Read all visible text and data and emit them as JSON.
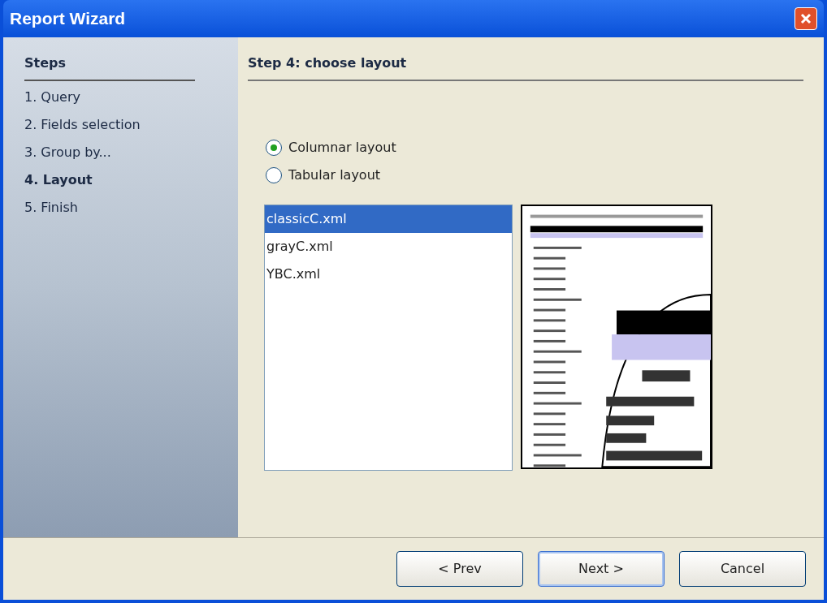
{
  "window": {
    "title": "Report Wizard"
  },
  "sidebar": {
    "heading": "Steps",
    "items": [
      {
        "label": "1. Query",
        "selected": false
      },
      {
        "label": "2. Fields selection",
        "selected": false
      },
      {
        "label": "3. Group by...",
        "selected": false
      },
      {
        "label": "4. Layout",
        "selected": true
      },
      {
        "label": "5. Finish",
        "selected": false
      }
    ]
  },
  "step_title": "Step 4: choose layout",
  "layout_options": [
    {
      "label": "Columnar layout",
      "selected": true
    },
    {
      "label": "Tabular layout",
      "selected": false
    }
  ],
  "templates": [
    {
      "label": "classicC.xml",
      "selected": true
    },
    {
      "label": "grayC.xml",
      "selected": false
    },
    {
      "label": "YBC.xml",
      "selected": false
    }
  ],
  "buttons": [
    {
      "label": "< Prev",
      "focused": false
    },
    {
      "label": "Next >",
      "focused": true
    },
    {
      "label": "Cancel",
      "focused": false
    }
  ]
}
